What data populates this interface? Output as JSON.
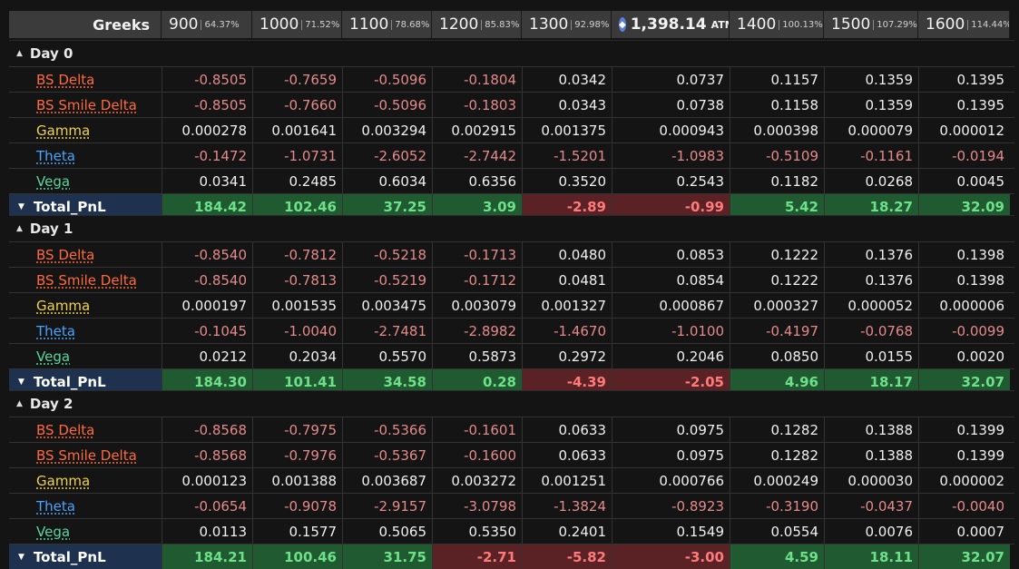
{
  "header": {
    "greeks_label": "Greeks",
    "columns": [
      {
        "strike": "900",
        "pct": "64.37%"
      },
      {
        "strike": "1000",
        "pct": "71.52%"
      },
      {
        "strike": "1100",
        "pct": "78.68%"
      },
      {
        "strike": "1200",
        "pct": "85.83%"
      },
      {
        "strike": "1300",
        "pct": "92.98%"
      },
      {
        "strike": "1,398.14",
        "pct": "ATM",
        "atm": true
      },
      {
        "strike": "1400",
        "pct": "100.13%"
      },
      {
        "strike": "1500",
        "pct": "107.29%"
      },
      {
        "strike": "1600",
        "pct": "114.44%"
      }
    ]
  },
  "colors": {
    "bs_delta": "#ff6a3d",
    "bs_smile_delta": "#ff6a3d",
    "gamma": "#f0d24a",
    "theta": "#4aa3ff",
    "vega": "#58d6a0"
  },
  "days": [
    {
      "label": "Day 0",
      "rows": [
        {
          "name": "BS Delta",
          "key": "bs_delta",
          "values": [
            "-0.8505",
            "-0.7659",
            "-0.5096",
            "-0.1804",
            "0.0342",
            "0.0737",
            "0.1157",
            "0.1359",
            "0.1395"
          ]
        },
        {
          "name": "BS Smile Delta",
          "key": "bs_smile_delta",
          "values": [
            "-0.8505",
            "-0.7660",
            "-0.5096",
            "-0.1803",
            "0.0343",
            "0.0738",
            "0.1158",
            "0.1359",
            "0.1395"
          ]
        },
        {
          "name": "Gamma",
          "key": "gamma",
          "values": [
            "0.000278",
            "0.001641",
            "0.003294",
            "0.002915",
            "0.001375",
            "0.000943",
            "0.000398",
            "0.000079",
            "0.000012"
          ]
        },
        {
          "name": "Theta",
          "key": "theta",
          "values": [
            "-0.1472",
            "-1.0731",
            "-2.6052",
            "-2.7442",
            "-1.5201",
            "-1.0983",
            "-0.5109",
            "-0.1161",
            "-0.0194"
          ]
        },
        {
          "name": "Vega",
          "key": "vega",
          "values": [
            "0.0341",
            "0.2485",
            "0.6034",
            "0.6356",
            "0.3520",
            "0.2543",
            "0.1182",
            "0.0268",
            "0.0045"
          ]
        }
      ],
      "total": {
        "name": "Total_PnL",
        "values": [
          "184.42",
          "102.46",
          "37.25",
          "3.09",
          "-2.89",
          "-0.99",
          "5.42",
          "18.27",
          "32.09"
        ]
      }
    },
    {
      "label": "Day 1",
      "rows": [
        {
          "name": "BS Delta",
          "key": "bs_delta",
          "values": [
            "-0.8540",
            "-0.7812",
            "-0.5218",
            "-0.1713",
            "0.0480",
            "0.0853",
            "0.1222",
            "0.1376",
            "0.1398"
          ]
        },
        {
          "name": "BS Smile Delta",
          "key": "bs_smile_delta",
          "values": [
            "-0.8540",
            "-0.7813",
            "-0.5219",
            "-0.1712",
            "0.0481",
            "0.0854",
            "0.1222",
            "0.1376",
            "0.1398"
          ]
        },
        {
          "name": "Gamma",
          "key": "gamma",
          "values": [
            "0.000197",
            "0.001535",
            "0.003475",
            "0.003079",
            "0.001327",
            "0.000867",
            "0.000327",
            "0.000052",
            "0.000006"
          ]
        },
        {
          "name": "Theta",
          "key": "theta",
          "values": [
            "-0.1045",
            "-1.0040",
            "-2.7481",
            "-2.8982",
            "-1.4670",
            "-1.0100",
            "-0.4197",
            "-0.0768",
            "-0.0099"
          ]
        },
        {
          "name": "Vega",
          "key": "vega",
          "values": [
            "0.0212",
            "0.2034",
            "0.5570",
            "0.5873",
            "0.2972",
            "0.2046",
            "0.0850",
            "0.0155",
            "0.0020"
          ]
        }
      ],
      "total": {
        "name": "Total_PnL",
        "values": [
          "184.30",
          "101.41",
          "34.58",
          "0.28",
          "-4.39",
          "-2.05",
          "4.96",
          "18.17",
          "32.07"
        ]
      }
    },
    {
      "label": "Day 2",
      "rows": [
        {
          "name": "BS Delta",
          "key": "bs_delta",
          "values": [
            "-0.8568",
            "-0.7975",
            "-0.5366",
            "-0.1601",
            "0.0633",
            "0.0975",
            "0.1282",
            "0.1388",
            "0.1399"
          ]
        },
        {
          "name": "BS Smile Delta",
          "key": "bs_smile_delta",
          "values": [
            "-0.8568",
            "-0.7976",
            "-0.5367",
            "-0.1600",
            "0.0633",
            "0.0975",
            "0.1282",
            "0.1388",
            "0.1399"
          ]
        },
        {
          "name": "Gamma",
          "key": "gamma",
          "values": [
            "0.000123",
            "0.001388",
            "0.003687",
            "0.003272",
            "0.001251",
            "0.000766",
            "0.000249",
            "0.000030",
            "0.000002"
          ]
        },
        {
          "name": "Theta",
          "key": "theta",
          "values": [
            "-0.0654",
            "-0.9078",
            "-2.9157",
            "-3.0798",
            "-1.3824",
            "-0.8923",
            "-0.3190",
            "-0.0437",
            "-0.0040"
          ]
        },
        {
          "name": "Vega",
          "key": "vega",
          "values": [
            "0.0113",
            "0.1577",
            "0.5065",
            "0.5350",
            "0.2401",
            "0.1549",
            "0.0554",
            "0.0076",
            "0.0007"
          ]
        }
      ],
      "total": {
        "name": "Total_PnL",
        "values": [
          "184.21",
          "100.46",
          "31.75",
          "-2.71",
          "-5.82",
          "-3.00",
          "4.59",
          "18.11",
          "32.07"
        ]
      }
    }
  ]
}
